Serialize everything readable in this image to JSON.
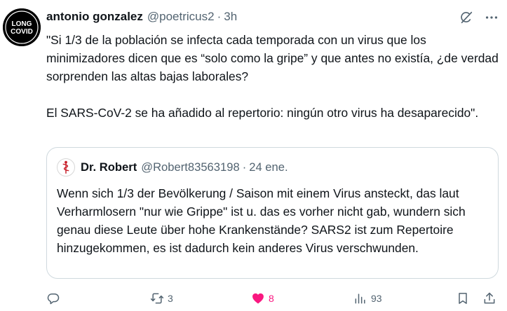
{
  "author": {
    "display_name": "antonio gonzalez",
    "handle": "@poetricus2",
    "separator": "·",
    "time": "3h",
    "avatar_text": [
      "LONG",
      "COVID"
    ]
  },
  "header_icons": [
    "grok-icon",
    "more-icon"
  ],
  "tweet": {
    "text": "\"Si 1/3 de la población se infecta cada temporada con un virus que los minimizadores dicen que es “solo como la gripe” y que antes no existía, ¿de verdad sorprenden las altas bajas laborales?\n\nEl SARS-CoV-2 se ha añadido al repertorio: ningún otro virus ha desaparecido\"."
  },
  "quote": {
    "display_name": "Dr. Robert",
    "handle": "@Robert83563198",
    "separator": "·",
    "time": "24 ene.",
    "text": "Wenn sich 1/3 der Bevölkerung / Saison mit einem Virus ansteckt, das laut Verharmlosern \"nur wie Grippe\" ist u. das es vorher nicht gab, wundern sich genau diese Leute über hohe Krankenstände? SARS2 ist zum Repertoire hinzugekommen, es ist dadurch kein anderes Virus verschwunden."
  },
  "actions": {
    "reply_count": "",
    "retweet_count": "3",
    "like_count": "8",
    "views_count": "93",
    "like_color": "#f91880"
  },
  "colors": {
    "text": "#0f1419",
    "secondary": "#536471",
    "border": "#cfd9de",
    "like": "#f91880"
  }
}
